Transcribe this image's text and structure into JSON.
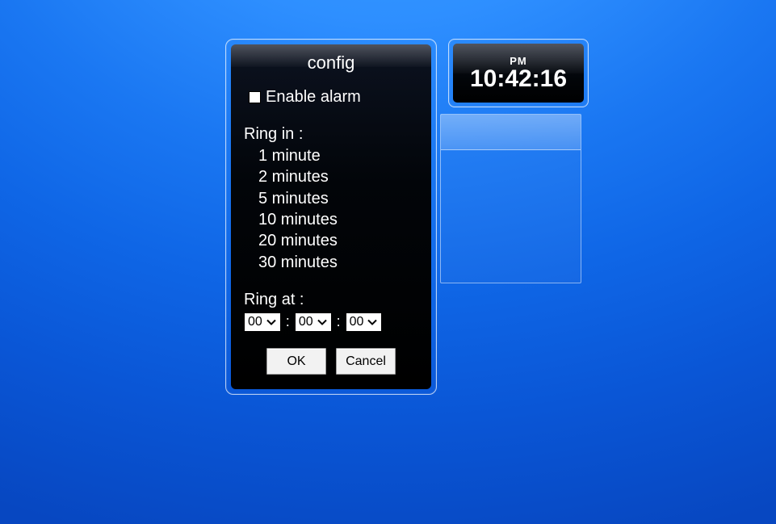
{
  "clock": {
    "period": "PM",
    "time": "10:42:16"
  },
  "config": {
    "title": "config",
    "enable_alarm_label": "Enable alarm",
    "enable_alarm_checked": false,
    "ring_in_label": "Ring in :",
    "ring_in_options": {
      "opt1": "1 minute",
      "opt2": "2 minutes",
      "opt3": "5 minutes",
      "opt4": "10 minutes",
      "opt5": "20 minutes",
      "opt6": "30 minutes"
    },
    "ring_at_label": "Ring at :",
    "ring_at": {
      "hours": "00",
      "minutes": "00",
      "seconds": "00"
    },
    "separator": ":",
    "buttons": {
      "ok": "OK",
      "cancel": "Cancel"
    }
  }
}
